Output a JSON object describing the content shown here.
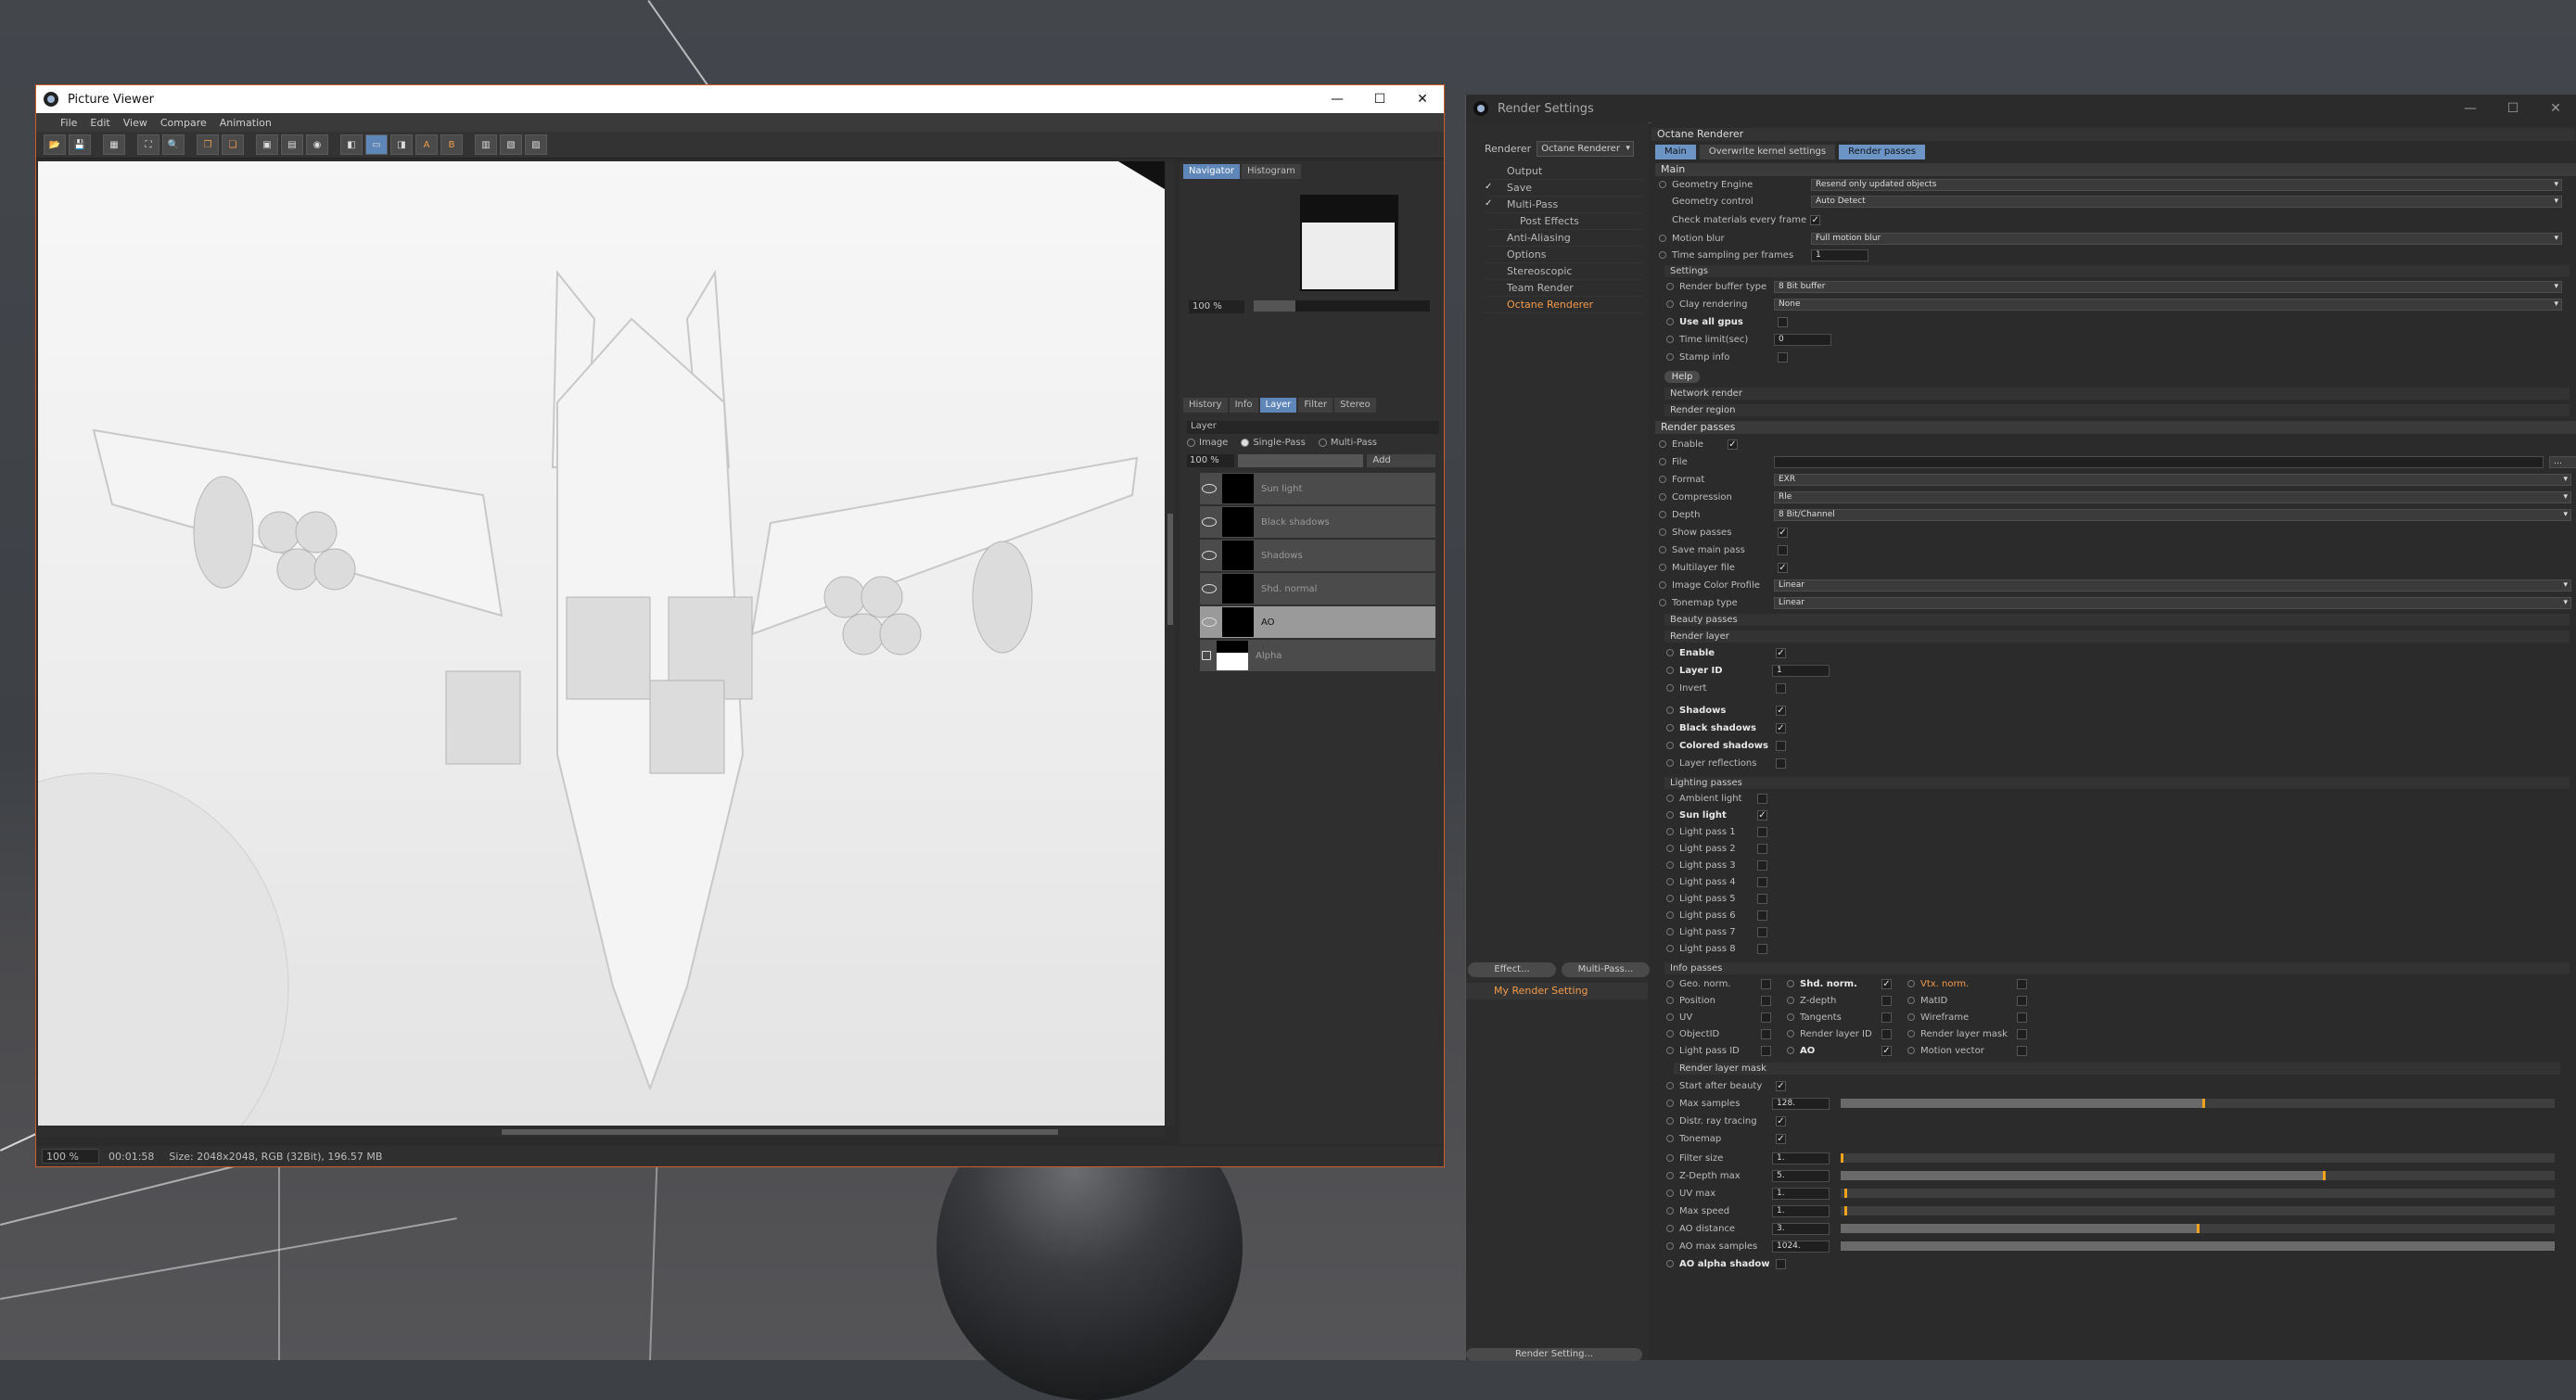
{
  "picture_viewer": {
    "title": "Picture Viewer",
    "menu": [
      "File",
      "Edit",
      "View",
      "Compare",
      "Animation"
    ],
    "side_tabs": [
      "Navigator",
      "Histogram"
    ],
    "nav_zoom": "100 %",
    "layer_tabs": [
      "History",
      "Info",
      "Layer",
      "Filter",
      "Stereo"
    ],
    "layer_header": "Layer",
    "layer_modes": [
      "Image",
      "Single-Pass",
      "Multi-Pass"
    ],
    "layer_pct": "100 %",
    "layer_add": "Add",
    "layers": [
      "Sun light",
      "Black shadows",
      "Shadows",
      "Shd. normal",
      "AO",
      "Alpha"
    ],
    "status_zoom": "100 %",
    "status_time": "00:01:58",
    "status_info": "Size: 2048x2048, RGB (32Bit), 196.57 MB"
  },
  "render_settings": {
    "title": "Render Settings",
    "renderer_label": "Renderer",
    "renderer_value": "Octane Renderer",
    "tree": [
      {
        "label": "Output",
        "check": ""
      },
      {
        "label": "Save",
        "check": "✓"
      },
      {
        "label": "Multi-Pass",
        "check": "✓"
      },
      {
        "label": "Post Effects",
        "check": ""
      },
      {
        "label": "Anti-Aliasing",
        "check": ""
      },
      {
        "label": "Options",
        "check": ""
      },
      {
        "label": "Stereoscopic",
        "check": ""
      },
      {
        "label": "Team Render",
        "check": ""
      },
      {
        "label": "Octane Renderer",
        "check": ""
      }
    ],
    "effect_btn": "Effect...",
    "multipass_btn": "Multi-Pass...",
    "my_setting": "My Render Setting",
    "render_setting_btn": "Render Setting...",
    "header": "Octane Renderer",
    "tabs": [
      "Main",
      "Overwrite kernel settings",
      "Render passes"
    ],
    "main": {
      "section": "Main",
      "geometry_engine_label": "Geometry Engine",
      "geometry_engine_value": "Resend only updated objects",
      "geometry_control_label": "Geometry control",
      "geometry_control_value": "Auto Detect",
      "check_materials_label": "Check materials every frame",
      "motion_blur_label": "Motion blur",
      "motion_blur_value": "Full motion blur",
      "time_sampling_label": "Time sampling per frames",
      "time_sampling_value": "1"
    },
    "settings": {
      "section": "Settings",
      "buffer_label": "Render buffer type",
      "buffer_value": "8 Bit buffer",
      "clay_label": "Clay rendering",
      "clay_value": "None",
      "use_all_gpus": "Use all gpus",
      "time_limit_label": "Time limit(sec)",
      "time_limit_value": "0",
      "stamp_label": "Stamp info",
      "help": "Help",
      "network": "Network render",
      "region": "Render region"
    },
    "passes": {
      "section": "Render passes",
      "enable": "Enable",
      "file": "File",
      "format_label": "Format",
      "format_value": "EXR",
      "compression_label": "Compression",
      "compression_value": "Rle",
      "depth_label": "Depth",
      "depth_value": "8 Bit/Channel",
      "show_passes": "Show passes",
      "save_main_pass": "Save main pass",
      "multilayer": "Multilayer file",
      "icp_label": "Image Color Profile",
      "icp_value": "Linear",
      "tonemap_label": "Tonemap type",
      "tonemap_value": "Linear",
      "beauty": "Beauty passes",
      "render_layer": "Render layer",
      "rl_enable": "Enable",
      "layer_id_label": "Layer ID",
      "layer_id_value": "1",
      "invert": "Invert",
      "shadows": "Shadows",
      "black_shadows": "Black shadows",
      "colored_shadows": "Colored shadows",
      "layer_reflections": "Layer reflections",
      "lighting": "Lighting passes",
      "lighting_items": [
        "Ambient light",
        "Sun light",
        "Light pass 1",
        "Light pass 2",
        "Light pass 3",
        "Light pass 4",
        "Light pass 5",
        "Light pass 6",
        "Light pass 7",
        "Light pass 8"
      ],
      "info": "Info passes",
      "info_col1": [
        "Geo. norm.",
        "Position",
        "UV",
        "ObjectID",
        "Light pass ID"
      ],
      "info_col2": [
        "Shd. norm.",
        "Z-depth",
        "Tangents",
        "Render layer ID",
        "AO"
      ],
      "info_col3": [
        "Vtx. norm.",
        "MatID",
        "Wireframe",
        "Render layer mask",
        "Motion vector"
      ],
      "mask": "Render layer mask",
      "start_after_beauty": "Start after beauty",
      "max_samples_label": "Max samples",
      "max_samples_value": "128.",
      "distr_ray": "Distr. ray tracing",
      "tonemap": "Tonemap",
      "filter_size_label": "Filter size",
      "filter_size_value": "1.",
      "zdepth_label": "Z-Depth max",
      "zdepth_value": "5.",
      "uv_max_label": "UV max",
      "uv_max_value": "1.",
      "max_speed_label": "Max speed",
      "max_speed_value": "1.",
      "ao_distance_label": "AO distance",
      "ao_distance_value": "3.",
      "ao_max_samples_label": "AO max samples",
      "ao_max_samples_value": "1024.",
      "ao_alpha_shadow": "AO alpha shadow"
    }
  },
  "colors": {
    "accent": "#6c95c6",
    "orange": "#f29b4a",
    "slider_knob": "#f2a21b"
  }
}
